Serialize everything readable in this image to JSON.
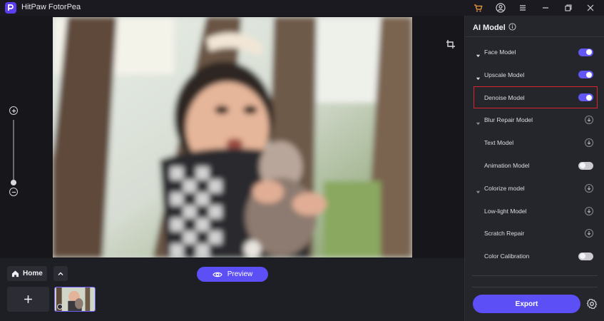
{
  "window": {
    "app_title": "HitPaw FotorPea",
    "icons": [
      "cart-icon",
      "user-icon",
      "menu-icon",
      "minimize-icon",
      "restore-icon",
      "close-icon"
    ]
  },
  "canvas": {
    "tools": [
      "crop-icon",
      "zoom-in-icon",
      "zoom-out-icon"
    ]
  },
  "bottom_bar": {
    "home_label": "Home",
    "preview_label": "Preview"
  },
  "panel": {
    "title": "AI Model",
    "items": [
      {
        "label": "Face Model",
        "caret": true,
        "control": "toggle",
        "on": true
      },
      {
        "label": "Upscale Model",
        "caret": true,
        "control": "toggle",
        "on": true
      },
      {
        "label": "Denoise Model",
        "caret": false,
        "control": "toggle",
        "on": true,
        "highlighted": true
      },
      {
        "label": "Blur Repair Model",
        "caret": true,
        "control": "download"
      },
      {
        "label": "Text Model",
        "caret": false,
        "control": "download"
      },
      {
        "label": "Animation Model",
        "caret": false,
        "control": "toggle",
        "on": false
      },
      {
        "label": "Colorize model",
        "caret": true,
        "control": "download"
      },
      {
        "label": "Low-light Model",
        "caret": false,
        "control": "download"
      },
      {
        "label": "Scratch Repair",
        "caret": false,
        "control": "download"
      },
      {
        "label": "Color Calibration",
        "caret": false,
        "control": "toggle",
        "on": false
      }
    ],
    "export_label": "Export"
  },
  "colors": {
    "accent": "#5b4ff5",
    "highlight_border": "#d9232f",
    "panel_bg": "#25252c"
  }
}
